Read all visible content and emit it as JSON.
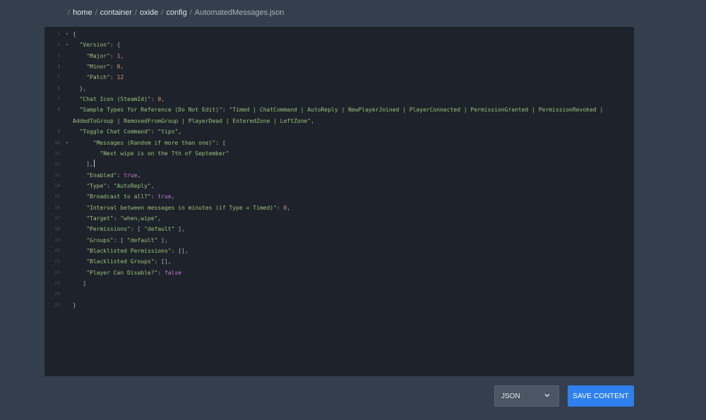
{
  "breadcrumb": {
    "separator": "/",
    "items": [
      "home",
      "container",
      "oxide",
      "config",
      "AutomatedMessages.json"
    ]
  },
  "editor": {
    "lines": [
      {
        "n": "1",
        "fold": true,
        "indent": 0,
        "tokens": [
          [
            "p",
            "{"
          ]
        ]
      },
      {
        "n": "2",
        "fold": true,
        "indent": 1,
        "tokens": [
          [
            "k",
            "\"Version\""
          ],
          [
            "p",
            ": {"
          ]
        ]
      },
      {
        "n": "3",
        "fold": false,
        "indent": 2,
        "tokens": [
          [
            "k",
            "\"Major\""
          ],
          [
            "p",
            ": "
          ],
          [
            "n",
            "1"
          ],
          [
            "p",
            ","
          ]
        ]
      },
      {
        "n": "4",
        "fold": false,
        "indent": 2,
        "tokens": [
          [
            "k",
            "\"Minor\""
          ],
          [
            "p",
            ": "
          ],
          [
            "n",
            "0"
          ],
          [
            "p",
            ","
          ]
        ]
      },
      {
        "n": "5",
        "fold": false,
        "indent": 2,
        "tokens": [
          [
            "k",
            "\"Patch\""
          ],
          [
            "p",
            ": "
          ],
          [
            "n",
            "12"
          ]
        ]
      },
      {
        "n": "6",
        "fold": false,
        "indent": 1,
        "tokens": [
          [
            "p",
            "},"
          ]
        ]
      },
      {
        "n": "7",
        "fold": false,
        "indent": 1,
        "tokens": [
          [
            "k",
            "\"Chat Icon (SteamId)\""
          ],
          [
            "p",
            ": "
          ],
          [
            "n",
            "0"
          ],
          [
            "p",
            ","
          ]
        ]
      },
      {
        "n": "8",
        "fold": false,
        "indent": 1,
        "tokens": [
          [
            "k",
            "\"Sample Types for Reference (Do Not Edit)\""
          ],
          [
            "p",
            ": "
          ],
          [
            "s",
            "\"Timed | ChatCommand | AutoReply | NewPlayerJoined | PlayerConnected | PermissionGranted | PermissionRevoked |"
          ]
        ]
      },
      {
        "n": "",
        "fold": false,
        "indent": 0,
        "tokens": [
          [
            "s",
            "AddedToGroup | RemovedFromGroup | PlayerDead | EnteredZone | LeftZone\""
          ],
          [
            "p",
            ","
          ]
        ]
      },
      {
        "n": "9",
        "fold": false,
        "indent": 1,
        "tokens": [
          [
            "k",
            "\"Toggle Chat Command\""
          ],
          [
            "p",
            ": "
          ],
          [
            "s",
            "\"tips\""
          ],
          [
            "p",
            ","
          ]
        ]
      },
      {
        "n": "10",
        "fold": true,
        "indent": 3,
        "tokens": [
          [
            "k",
            "\"Messages (Random if more than one)\""
          ],
          [
            "p",
            ": ["
          ]
        ]
      },
      {
        "n": "11",
        "fold": false,
        "indent": 4,
        "tokens": [
          [
            "s",
            "\"Next wipe is on the 7th of September\""
          ]
        ]
      },
      {
        "n": "12",
        "fold": false,
        "indent": 2,
        "tokens": [
          [
            "p",
            "],"
          ]
        ],
        "cursor": true
      },
      {
        "n": "13",
        "fold": false,
        "indent": 2,
        "tokens": [
          [
            "k",
            "\"Enabled\""
          ],
          [
            "p",
            ": "
          ],
          [
            "b",
            "true"
          ],
          [
            "p",
            ","
          ]
        ]
      },
      {
        "n": "14",
        "fold": false,
        "indent": 2,
        "tokens": [
          [
            "k",
            "\"Type\""
          ],
          [
            "p",
            ": "
          ],
          [
            "s",
            "\"AutoReply\""
          ],
          [
            "p",
            ","
          ]
        ]
      },
      {
        "n": "15",
        "fold": false,
        "indent": 2,
        "tokens": [
          [
            "k",
            "\"Broadcast to all?\""
          ],
          [
            "p",
            ": "
          ],
          [
            "b",
            "true"
          ],
          [
            "p",
            ","
          ]
        ]
      },
      {
        "n": "16",
        "fold": false,
        "indent": 2,
        "tokens": [
          [
            "k",
            "\"Interval between messages in minutes (if Type = Timed)\""
          ],
          [
            "p",
            ": "
          ],
          [
            "n",
            "0"
          ],
          [
            "p",
            ","
          ]
        ]
      },
      {
        "n": "17",
        "fold": false,
        "indent": 2,
        "tokens": [
          [
            "k",
            "\"Target\""
          ],
          [
            "p",
            ": "
          ],
          [
            "s",
            "\"when,wipe\""
          ],
          [
            "p",
            ","
          ]
        ]
      },
      {
        "n": "18",
        "fold": false,
        "indent": 2,
        "tokens": [
          [
            "k",
            "\"Permissions\""
          ],
          [
            "p",
            ": [ "
          ],
          [
            "s",
            "\"default\""
          ],
          [
            "p",
            " ],"
          ]
        ]
      },
      {
        "n": "19",
        "fold": false,
        "indent": 2,
        "tokens": [
          [
            "k",
            "\"Groups\""
          ],
          [
            "p",
            ": [ "
          ],
          [
            "s",
            "\"default\""
          ],
          [
            "p",
            " ],"
          ]
        ]
      },
      {
        "n": "20",
        "fold": false,
        "indent": 2,
        "tokens": [
          [
            "k",
            "\"Blacklisted Permissions\""
          ],
          [
            "p",
            ": [],"
          ]
        ]
      },
      {
        "n": "21",
        "fold": false,
        "indent": 2,
        "tokens": [
          [
            "k",
            "\"Blacklisted Groups\""
          ],
          [
            "p",
            ": [],"
          ]
        ]
      },
      {
        "n": "22",
        "fold": false,
        "indent": 2,
        "tokens": [
          [
            "k",
            "\"Player Can Disable?\""
          ],
          [
            "p",
            ": "
          ],
          [
            "b",
            "false"
          ]
        ]
      },
      {
        "n": "23",
        "fold": false,
        "indent": 1.5,
        "tokens": [
          [
            "p",
            "]"
          ]
        ]
      },
      {
        "n": "24",
        "fold": false,
        "indent": 0,
        "tokens": []
      },
      {
        "n": "25",
        "fold": false,
        "indent": 0,
        "tokens": [
          [
            "p",
            "}"
          ]
        ]
      }
    ]
  },
  "footer": {
    "language_select": {
      "value": "JSON",
      "icon": "chevron-down-icon"
    },
    "save_label": "SAVE CONTENT"
  },
  "colors": {
    "background": "#333f4c",
    "editor_background": "#1e222a",
    "key_string": "#98c379",
    "number": "#d19a66",
    "boolean": "#c678dd",
    "save_button": "#2f80ed"
  }
}
